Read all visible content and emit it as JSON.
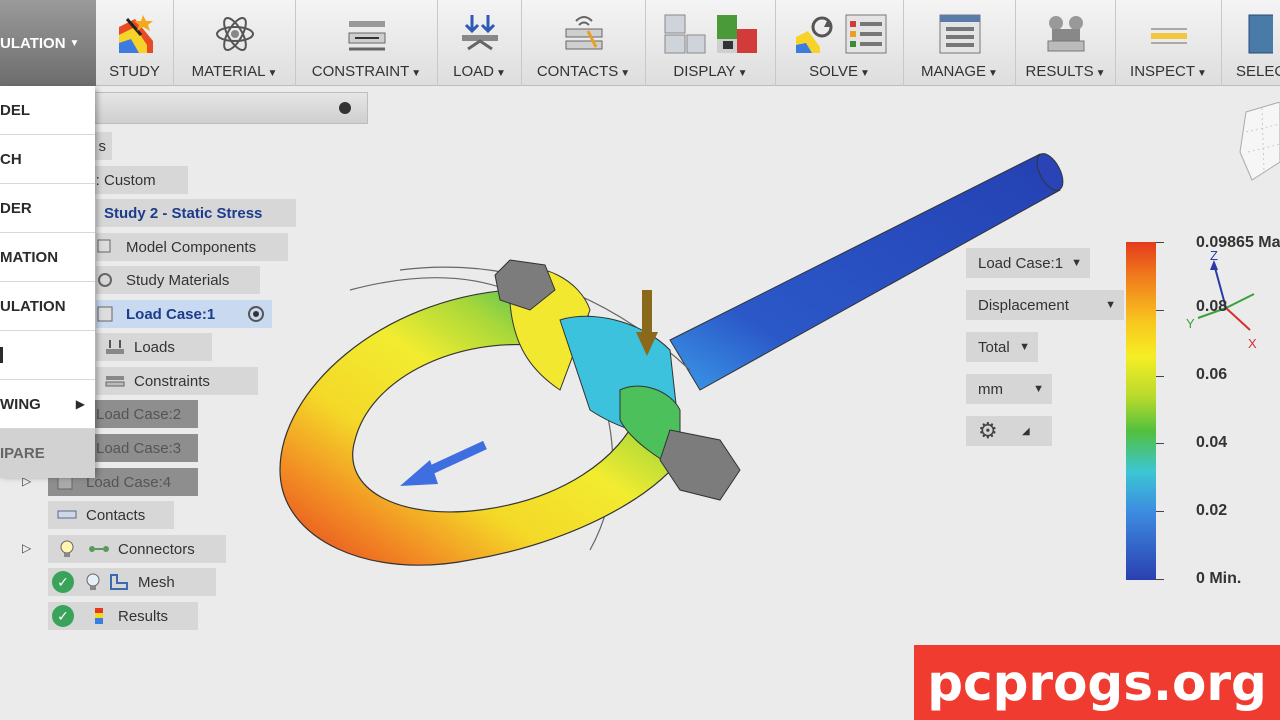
{
  "toolbar": {
    "workspace": "ULATION",
    "groups": [
      "STUDY",
      "MATERIAL",
      "CONSTRAINT",
      "LOAD",
      "CONTACTS",
      "DISPLAY",
      "SOLVE",
      "MANAGE",
      "RESULTS",
      "INSPECT",
      "SELEC"
    ]
  },
  "workspace_menu": {
    "items": [
      "DEL",
      "CH",
      "DER",
      "MATION",
      "ULATION",
      "",
      "WING",
      "IPARE"
    ]
  },
  "browser": {
    "node_s": "s",
    "results_custom": "ts: Custom",
    "study": "Study 2 - Static Stress",
    "model_components": "Model Components",
    "study_materials": "Study Materials",
    "load_case_1": "Load Case:1",
    "loads": "Loads",
    "constraints": "Constraints",
    "load_case_2": "Load Case:2",
    "load_case_3": "Load Case:3",
    "load_case_4": "Load Case:4",
    "contacts": "Contacts",
    "connectors": "Connectors",
    "mesh": "Mesh",
    "results": "Results"
  },
  "results_panel": {
    "load_case": "Load Case:1",
    "result_type": "Displacement",
    "component": "Total",
    "unit": "mm"
  },
  "colorbar": {
    "max_label": "0.09865 Ma",
    "labels": [
      "0.08",
      "0.06",
      "0.04",
      "0.02"
    ],
    "min_label": "0 Min."
  },
  "axes": {
    "z": "Z",
    "y": "Y",
    "x": "X"
  },
  "watermark": "pcprogs.org",
  "colors": {
    "accent_blue": "#1c3c8c",
    "watermark_red": "#f03c30",
    "check_green": "#3aa35a"
  }
}
